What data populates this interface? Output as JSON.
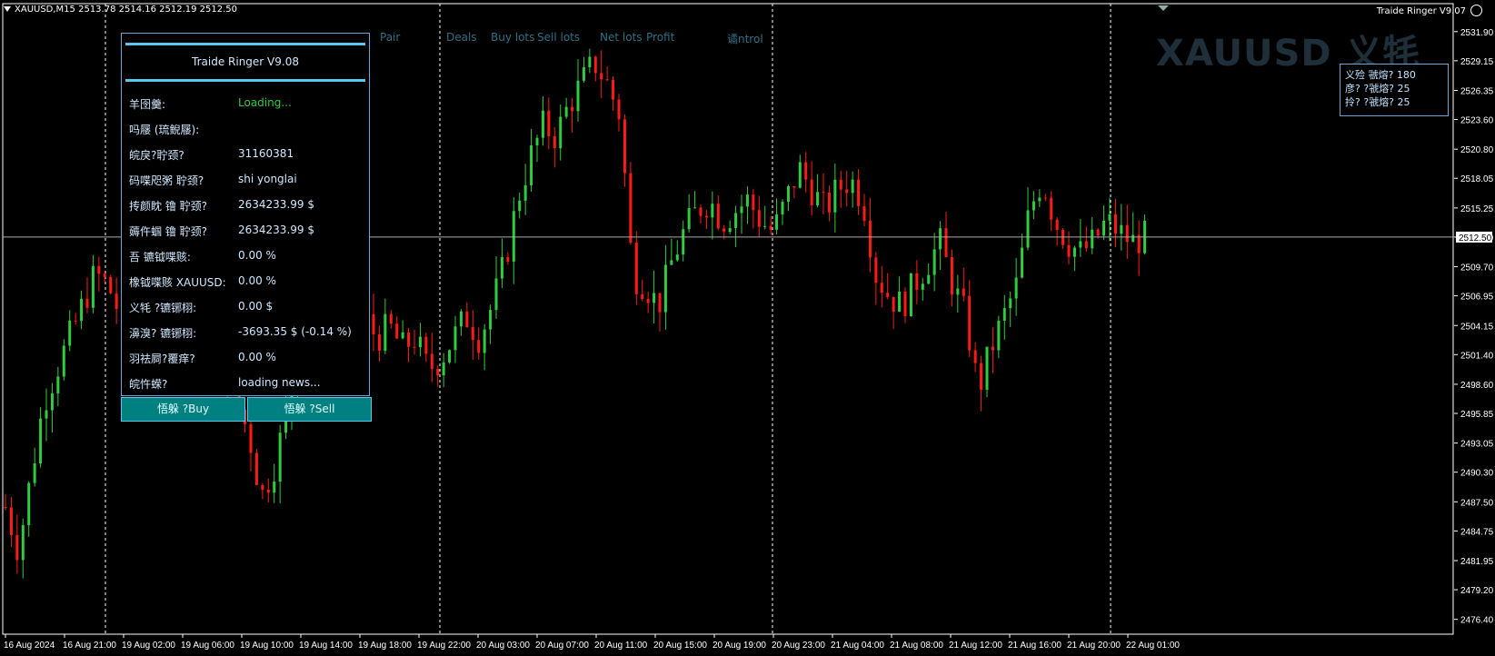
{
  "header": {
    "symbol_info": "XAUUSD,M15  2513.78 2514.16 2512.19 2512.50",
    "ea_name": "Traide Ringer V9.07"
  },
  "watermark": "XAUUSD 义牦",
  "columns": [
    "Pair",
    "Deals",
    "Buy lots",
    "Sell lots",
    "Net lots",
    "Profit",
    "谲ntrol"
  ],
  "panel": {
    "title": "Traide Ringer V9.08",
    "rows": [
      {
        "label": "羊囹羹:",
        "value": "Loading...",
        "green": true
      },
      {
        "label": "吗屦    (琉鲵屦):",
        "value": ""
      },
      {
        "label": "皖戾?聍颈?",
        "value": "31160381"
      },
      {
        "label": "码喋咫粥 聍颈?",
        "value": "shi yonglai"
      },
      {
        "label": "抟颜眈 镥 聍颈?",
        "value": "2634233.99 $"
      },
      {
        "label": "薅仵蝈 镥 聍颈?",
        "value": "2634233.99 $"
      },
      {
        "label": "吾          镳钺喋赅:",
        "value": "0.00 %"
      },
      {
        "label": "橡钺喋赅 XAUUSD:",
        "value": "0.00 %"
      },
      {
        "label": "义牦     ?镳铘栩:",
        "value": "0.00 $"
      },
      {
        "label": "濞溴? 镳铘栩:",
        "value": "-3693.35 $  (-0.14 %)"
      },
      {
        "label": "羽祛屙?覆痒?",
        "value": "0.00 %"
      },
      {
        "label": "皖忤蝾?",
        "value": "loading news..."
      }
    ]
  },
  "buttons": {
    "buy": "悟躲     ?Buy",
    "sell": "悟躲     ?Sell"
  },
  "infobox": {
    "lines": [
      "义殓 虢熔? 180",
      "彦?    ?虢熔? 25",
      "拎?    ?虢熔? 25"
    ]
  },
  "chart_data": {
    "type": "candlestick",
    "symbol": "XAUUSD",
    "timeframe": "M15",
    "current_price": 2512.5,
    "ylim": [
      2475.0,
      2533.0
    ],
    "y_ticks": [
      2531.9,
      2529.15,
      2526.35,
      2523.6,
      2520.8,
      2518.05,
      2515.25,
      2512.5,
      2509.7,
      2506.95,
      2504.15,
      2501.4,
      2498.6,
      2495.85,
      2493.05,
      2490.3,
      2487.5,
      2484.75,
      2481.95,
      2479.2,
      2476.4
    ],
    "x_ticks": [
      "16 Aug 2024",
      "16 Aug 21:00",
      "19 Aug 02:00",
      "19 Aug 06:00",
      "19 Aug 10:00",
      "19 Aug 14:00",
      "19 Aug 18:00",
      "19 Aug 22:00",
      "20 Aug 03:00",
      "20 Aug 07:00",
      "20 Aug 11:00",
      "20 Aug 15:00",
      "20 Aug 19:00",
      "20 Aug 23:00",
      "21 Aug 04:00",
      "21 Aug 08:00",
      "21 Aug 12:00",
      "21 Aug 16:00",
      "21 Aug 20:00",
      "22 Aug 01:00"
    ],
    "path_closes": [
      2487,
      2483,
      2490,
      2497,
      2500,
      2503,
      2506,
      2509,
      2508,
      2505,
      2507,
      2503,
      2509,
      2506,
      2508,
      2503,
      2505,
      2501,
      2497,
      2494,
      2488,
      2491,
      2496,
      2502,
      2504,
      2505,
      2503,
      2504,
      2505,
      2503,
      2504,
      2502,
      2503,
      2500,
      2501,
      2503,
      2505,
      2503,
      2506,
      2510,
      2516,
      2520,
      2523,
      2522,
      2525,
      2527,
      2529,
      2527,
      2524,
      2509,
      2508,
      2506,
      2510,
      2513,
      2515,
      2516,
      2514,
      2515,
      2516,
      2514,
      2513,
      2516,
      2519,
      2517,
      2515,
      2517,
      2518,
      2516,
      2509,
      2507,
      2506,
      2508,
      2510,
      2512,
      2508,
      2505,
      2498,
      2502,
      2505,
      2508,
      2515,
      2518,
      2514,
      2512,
      2511,
      2512,
      2514,
      2513,
      2512,
      2512.5
    ],
    "gridlines": false,
    "session_separators": true
  }
}
